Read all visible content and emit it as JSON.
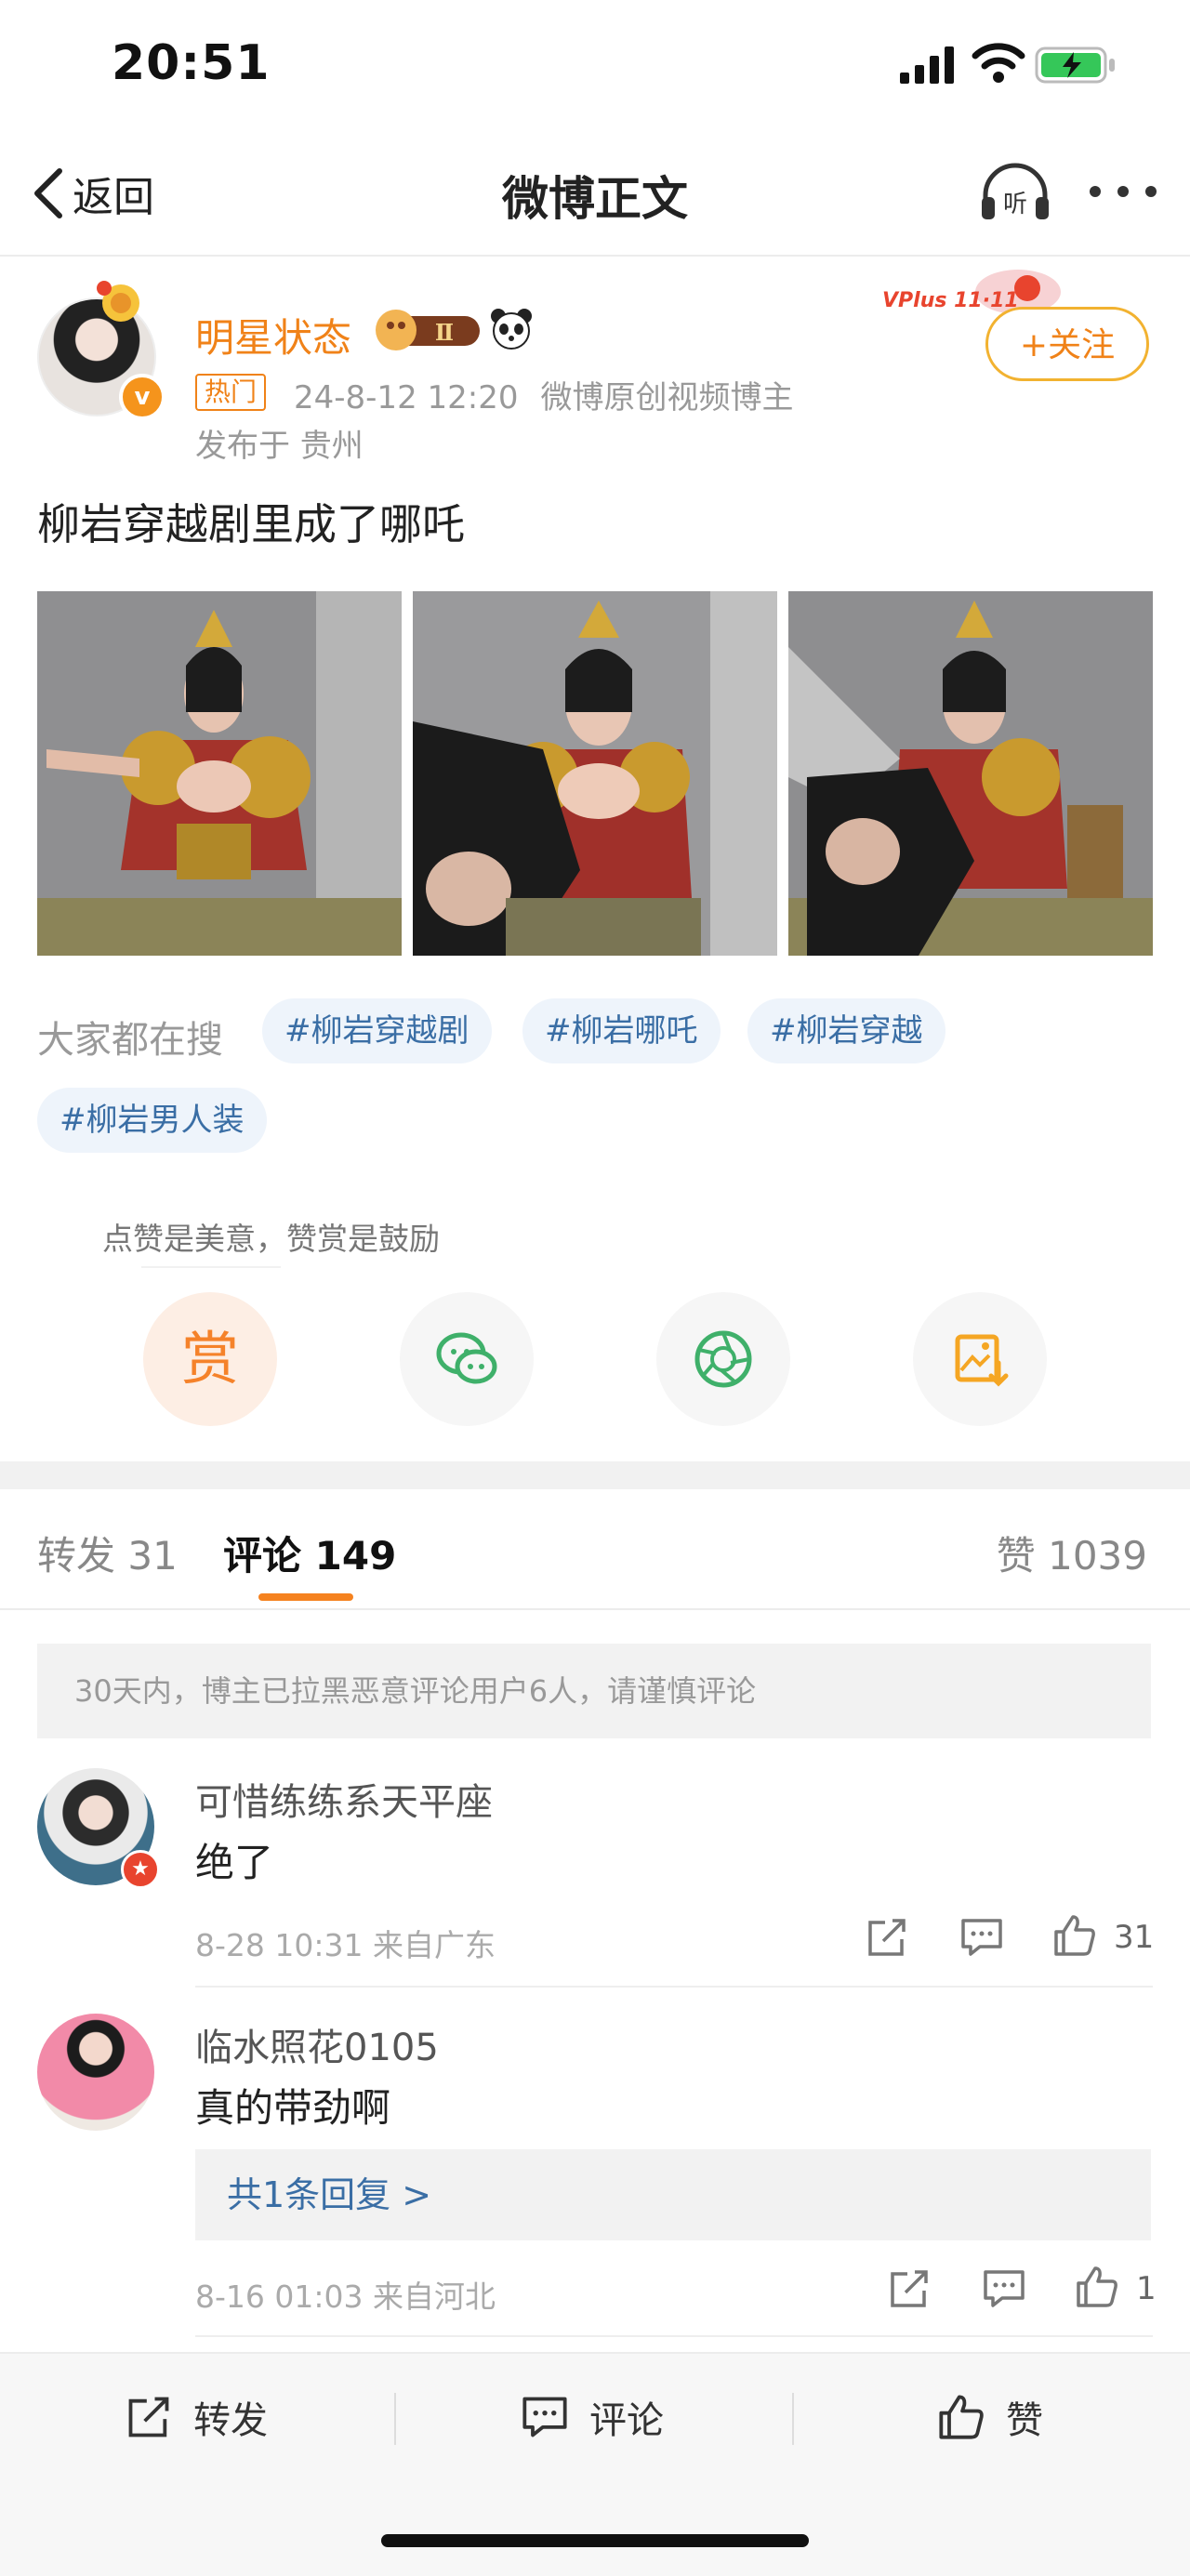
{
  "status_bar": {
    "time": "20:51"
  },
  "nav": {
    "back_label": "返回",
    "title": "微博正文",
    "listen_icon": "headphones-listen-icon",
    "listen_label": "听",
    "more_icon": "more-dots-icon"
  },
  "post": {
    "author": "明星状态",
    "medal_level": "Ⅱ",
    "hot_tag": "热门",
    "time": "24-8-12 12:20",
    "source": "微博原创视频博主",
    "location": "发布于 贵州",
    "follow_label": "+关注",
    "vplus_badge": "VPlus 11·11",
    "verified_mark": "v",
    "text": "柳岩穿越剧里成了哪吒"
  },
  "search": {
    "label": "大家都在搜",
    "topics": [
      "#柳岩穿越剧",
      "#柳岩哪吒",
      "#柳岩穿越",
      "#柳岩男人装"
    ]
  },
  "reward": {
    "tip": "点赞是美意，赞赏是鼓励",
    "reward_label": "赏"
  },
  "tabs": {
    "repost": "转发 31",
    "comment": "评论 149",
    "like": "赞 1039"
  },
  "notice": "30天内，博主已拉黑恶意评论用户6人，请谨慎评论",
  "comments": [
    {
      "name": "可惜练练系天平座",
      "text": "绝了",
      "meta": "8-28 10:31  来自广东",
      "likes": "31"
    },
    {
      "name": "临水照花0105",
      "text": "真的带劲啊",
      "reply_link": "共1条回复 >",
      "meta": "8-16 01:03  来自河北",
      "likes": "1"
    }
  ],
  "bottom_bar": {
    "repost": "转发",
    "comment": "评论",
    "like": "赞"
  },
  "colors": {
    "accent_orange": "#f08218",
    "topic_blue": "#3a6ea5",
    "topic_bg": "#eef4fb"
  }
}
